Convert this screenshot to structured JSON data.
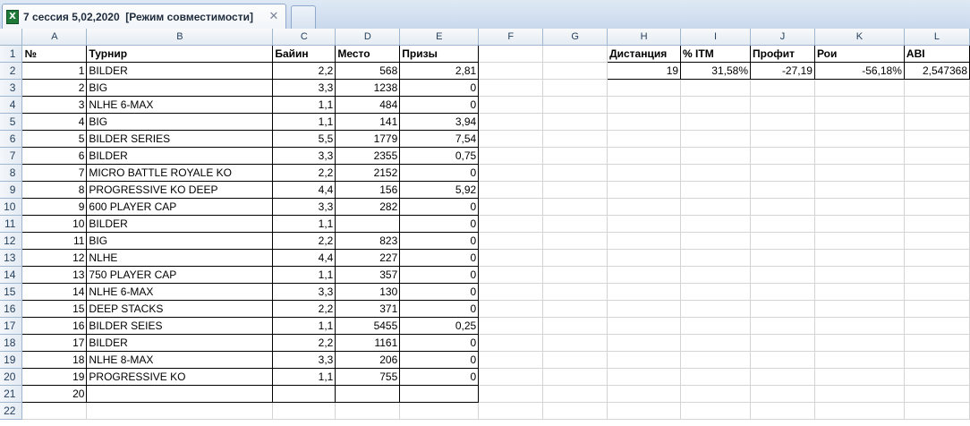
{
  "tab": {
    "icon": "excel-workbook-icon",
    "title": "7 сессия 5,02,2020  [Режим совместимости]",
    "close_glyph": "✕"
  },
  "columns": [
    "A",
    "B",
    "C",
    "D",
    "E",
    "F",
    "G",
    "H",
    "I",
    "J",
    "K",
    "L"
  ],
  "headers": {
    "A": "№",
    "B": "Турнир",
    "C": "Байин",
    "D": "Место",
    "E": "Призы",
    "H": "Дистанция",
    "I": "% ITM",
    "J": "Профит",
    "K": "Рои",
    "L": "ABI"
  },
  "summary": {
    "distance": "19",
    "itm": "31,58%",
    "profit": "-27,19",
    "roi": "-56,18%",
    "abi": "2,547368"
  },
  "rows": [
    {
      "num": "1",
      "name": "BILDER",
      "buyin": "2,2",
      "place": "568",
      "prize": "2,81"
    },
    {
      "num": "2",
      "name": "BIG",
      "buyin": "3,3",
      "place": "1238",
      "prize": "0"
    },
    {
      "num": "3",
      "name": "NLHE 6-MAX",
      "buyin": "1,1",
      "place": "484",
      "prize": "0"
    },
    {
      "num": "4",
      "name": "BIG",
      "buyin": "1,1",
      "place": "141",
      "prize": "3,94"
    },
    {
      "num": "5",
      "name": "BILDER SERIES",
      "buyin": "5,5",
      "place": "1779",
      "prize": "7,54"
    },
    {
      "num": "6",
      "name": "BILDER",
      "buyin": "3,3",
      "place": "2355",
      "prize": "0,75"
    },
    {
      "num": "7",
      "name": "MICRO BATTLE ROYALE KO",
      "buyin": "2,2",
      "place": "2152",
      "prize": "0"
    },
    {
      "num": "8",
      "name": "PROGRESSIVE KO DEEP",
      "buyin": "4,4",
      "place": "156",
      "prize": "5,92"
    },
    {
      "num": "9",
      "name": "600 PLAYER CAP",
      "buyin": "3,3",
      "place": "282",
      "prize": "0"
    },
    {
      "num": "10",
      "name": "BILDER",
      "buyin": "1,1",
      "place": "",
      "prize": "0"
    },
    {
      "num": "11",
      "name": "BIG",
      "buyin": "2,2",
      "place": "823",
      "prize": "0"
    },
    {
      "num": "12",
      "name": "NLHE",
      "buyin": "4,4",
      "place": "227",
      "prize": "0"
    },
    {
      "num": "13",
      "name": "750 PLAYER CAP",
      "buyin": "1,1",
      "place": "357",
      "prize": "0"
    },
    {
      "num": "14",
      "name": "NLHE 6-MAX",
      "buyin": "3,3",
      "place": "130",
      "prize": "0"
    },
    {
      "num": "15",
      "name": "DEEP STACKS",
      "buyin": "2,2",
      "place": "371",
      "prize": "0"
    },
    {
      "num": "16",
      "name": "BILDER SEIES",
      "buyin": "1,1",
      "place": "5455",
      "prize": "0,25"
    },
    {
      "num": "17",
      "name": "BILDER",
      "buyin": "2,2",
      "place": "1161",
      "prize": "0"
    },
    {
      "num": "18",
      "name": "NLHE 8-MAX",
      "buyin": "3,3",
      "place": "206",
      "prize": "0"
    },
    {
      "num": "19",
      "name": "PROGRESSIVE KO",
      "buyin": "1,1",
      "place": "755",
      "prize": "0"
    },
    {
      "num": "20",
      "name": "",
      "buyin": "",
      "place": "",
      "prize": ""
    }
  ]
}
